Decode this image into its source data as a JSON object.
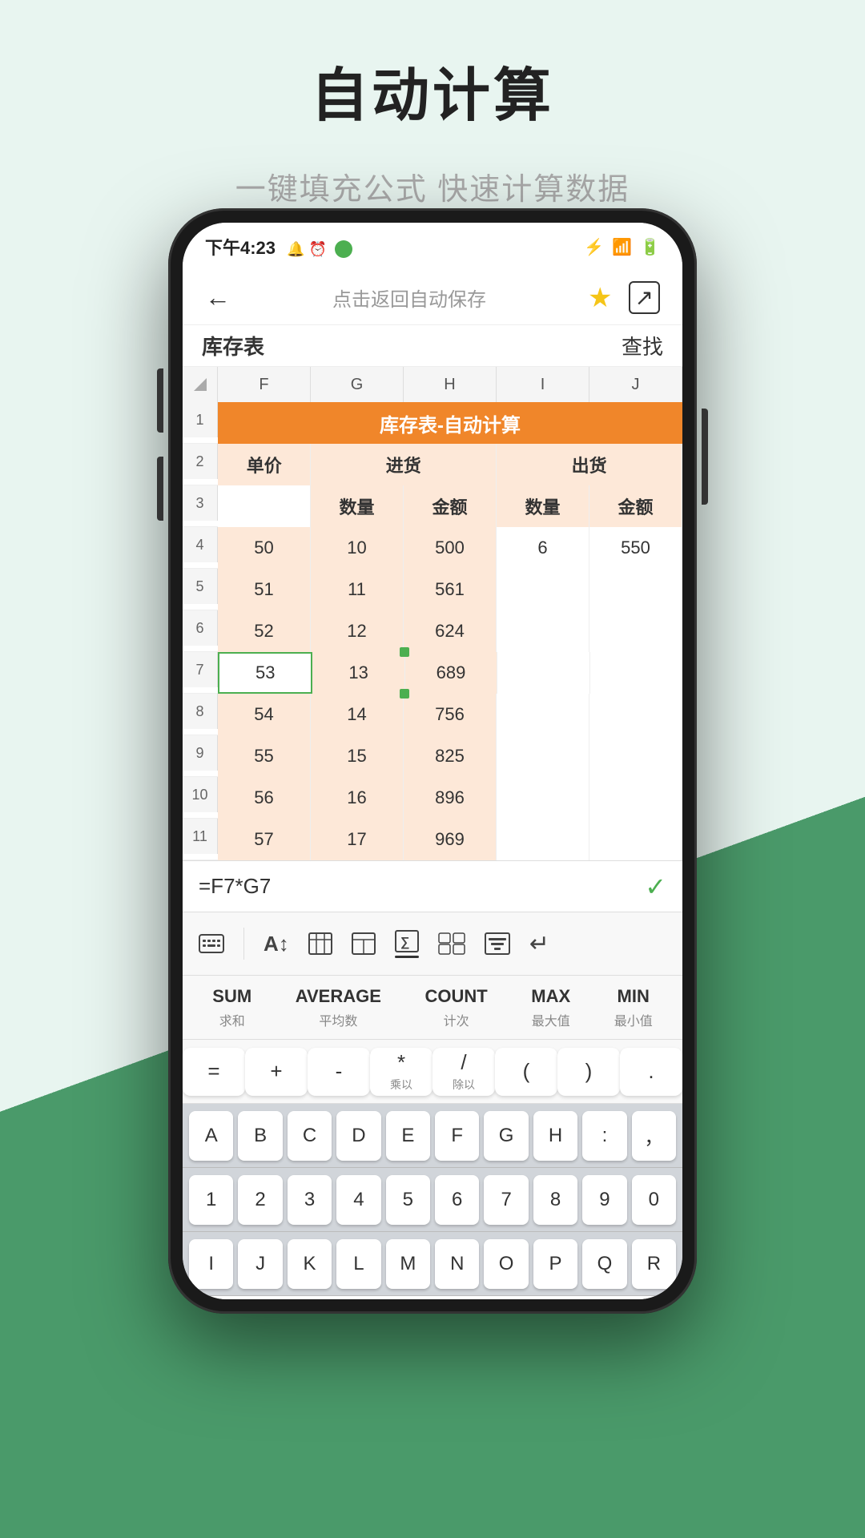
{
  "page": {
    "title": "自动计算",
    "subtitle": "一键填充公式 快速计算数据"
  },
  "status_bar": {
    "time": "下午4:23",
    "icons": "bluetooth signal wifi battery"
  },
  "nav": {
    "back": "←",
    "center": "点击返回自动保存",
    "star": "★",
    "share": "⬡"
  },
  "sheet": {
    "name": "库存表",
    "search": "查找",
    "header_title": "库存表-自动计算",
    "col_headers": [
      "F",
      "G",
      "H",
      "I",
      "J"
    ],
    "row_numbers": [
      1,
      2,
      3,
      4,
      5,
      6,
      7,
      8,
      9,
      10,
      11
    ],
    "rows": [
      {
        "num": 2,
        "cells": [
          {
            "text": "单价",
            "type": "sub-header"
          },
          {
            "text": "进货",
            "type": "sub-header",
            "span": 2
          },
          {
            "text": "",
            "type": "empty"
          },
          {
            "text": "出货",
            "type": "sub-header",
            "span": 2
          },
          {
            "text": "",
            "type": "empty"
          }
        ]
      },
      {
        "num": 3,
        "cells": [
          {
            "text": "",
            "type": "normal"
          },
          {
            "text": "数量",
            "type": "sub-header"
          },
          {
            "text": "金额",
            "type": "sub-header"
          },
          {
            "text": "数量",
            "type": "sub-header"
          },
          {
            "text": "金额",
            "type": "sub-header"
          }
        ]
      },
      {
        "num": 4,
        "cells": [
          {
            "text": "50",
            "type": "orange-bg"
          },
          {
            "text": "10",
            "type": "orange-bg"
          },
          {
            "text": "500",
            "type": "orange-bg"
          },
          {
            "text": "6",
            "type": "normal"
          },
          {
            "text": "550",
            "type": "normal"
          }
        ]
      },
      {
        "num": 5,
        "cells": [
          {
            "text": "51",
            "type": "orange-bg"
          },
          {
            "text": "11",
            "type": "orange-bg"
          },
          {
            "text": "561",
            "type": "orange-bg"
          },
          {
            "text": "",
            "type": "normal"
          },
          {
            "text": "",
            "type": "normal"
          }
        ]
      },
      {
        "num": 6,
        "cells": [
          {
            "text": "52",
            "type": "orange-bg"
          },
          {
            "text": "12",
            "type": "orange-bg"
          },
          {
            "text": "624",
            "type": "orange-bg"
          },
          {
            "text": "",
            "type": "normal"
          },
          {
            "text": "",
            "type": "normal"
          }
        ]
      },
      {
        "num": 7,
        "cells": [
          {
            "text": "53",
            "type": "selected"
          },
          {
            "text": "13",
            "type": "orange-bg"
          },
          {
            "text": "689",
            "type": "orange-bg"
          },
          {
            "text": "",
            "type": "normal"
          },
          {
            "text": "",
            "type": "normal"
          }
        ]
      },
      {
        "num": 8,
        "cells": [
          {
            "text": "54",
            "type": "orange-bg"
          },
          {
            "text": "14",
            "type": "orange-bg"
          },
          {
            "text": "756",
            "type": "orange-bg"
          },
          {
            "text": "",
            "type": "normal"
          },
          {
            "text": "",
            "type": "normal"
          }
        ]
      },
      {
        "num": 9,
        "cells": [
          {
            "text": "55",
            "type": "orange-bg"
          },
          {
            "text": "15",
            "type": "orange-bg"
          },
          {
            "text": "825",
            "type": "orange-bg"
          },
          {
            "text": "",
            "type": "normal"
          },
          {
            "text": "",
            "type": "normal"
          }
        ]
      },
      {
        "num": 10,
        "cells": [
          {
            "text": "56",
            "type": "orange-bg"
          },
          {
            "text": "16",
            "type": "orange-bg"
          },
          {
            "text": "896",
            "type": "orange-bg"
          },
          {
            "text": "",
            "type": "normal"
          },
          {
            "text": "",
            "type": "normal"
          }
        ]
      },
      {
        "num": 11,
        "cells": [
          {
            "text": "57",
            "type": "orange-bg"
          },
          {
            "text": "17",
            "type": "orange-bg"
          },
          {
            "text": "969",
            "type": "orange-bg"
          },
          {
            "text": "",
            "type": "normal"
          },
          {
            "text": "",
            "type": "normal"
          }
        ]
      }
    ]
  },
  "formula_bar": {
    "formula": "=F7*G7",
    "check": "✓"
  },
  "toolbar": {
    "icons": [
      "▦",
      "A↕",
      "⊞",
      "⊡",
      "∑",
      "⊞⊞",
      "⊟",
      "↵"
    ]
  },
  "functions": [
    {
      "name": "SUM",
      "sub": "求和"
    },
    {
      "name": "AVERAGE",
      "sub": "平均数"
    },
    {
      "name": "COUNT",
      "sub": "计次"
    },
    {
      "name": "MAX",
      "sub": "最大值"
    },
    {
      "name": "MIN",
      "sub": "最小值"
    }
  ],
  "operators": [
    "=",
    "+",
    "-",
    {
      "main": "*",
      "sub": "乘以"
    },
    {
      "main": "/",
      "sub": "除以"
    },
    "(",
    ")",
    "."
  ],
  "letters_row1": [
    "A",
    "B",
    "C",
    "D",
    "E",
    "F",
    "G",
    "H",
    ":",
    "，"
  ],
  "letters_row2": [
    "1",
    "2",
    "3",
    "4",
    "5",
    "6",
    "7",
    "8",
    "9",
    "0"
  ],
  "letters_row3": [
    "I",
    "J",
    "K",
    "L",
    "M",
    "N",
    "O",
    "P",
    "Q",
    "R"
  ]
}
